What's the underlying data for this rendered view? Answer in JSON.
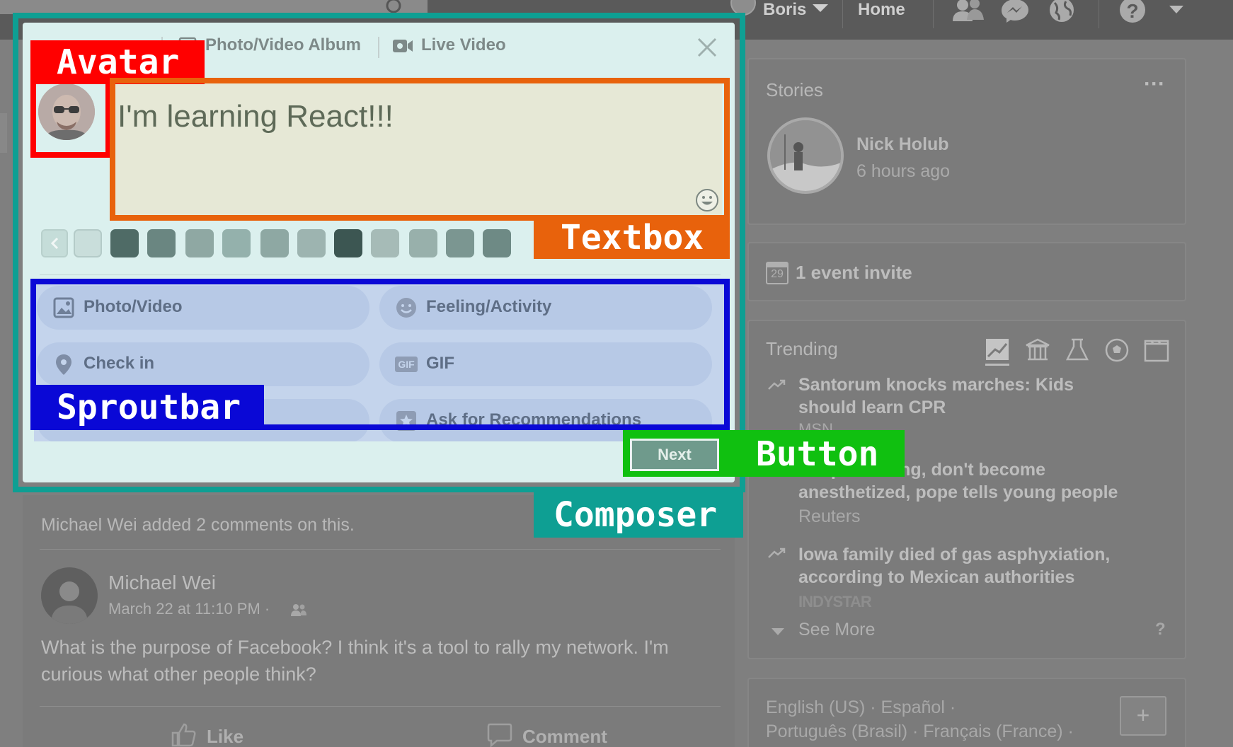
{
  "topbar": {
    "user_name": "Boris",
    "home_label": "Home"
  },
  "composer": {
    "tabs": [
      "Photo/Video Album",
      "Live Video"
    ],
    "text": "I'm learning React!!!",
    "sprout_items": [
      {
        "label": "Photo/Video",
        "icon": "photo-icon"
      },
      {
        "label": "Feeling/Activity",
        "icon": "smiley-icon"
      },
      {
        "label": "Check in",
        "icon": "location-pin-icon"
      },
      {
        "label": "GIF",
        "icon": "gif-icon"
      },
      {
        "label": "",
        "icon": ""
      },
      {
        "label": "Ask for Recommendations",
        "icon": "star-icon"
      }
    ],
    "gif_badge": "GIF",
    "next_label": "Next"
  },
  "annotations": {
    "avatar": "Avatar",
    "textbox": "Textbox",
    "sproutbar": "Sproutbar",
    "button": "Button",
    "composer": "Composer",
    "colors": {
      "avatar": "#ff0000",
      "textbox": "#e8620c",
      "sproutbar": "#0a08d6",
      "button": "#10c010",
      "composer": "#0e9f93"
    }
  },
  "stories": {
    "title": "Stories",
    "name": "Nick Holub",
    "time": "6 hours ago"
  },
  "events": {
    "date_badge": "29",
    "label": "1 event invite"
  },
  "trending": {
    "title": "Trending",
    "items": [
      {
        "headline": "Santorum knocks marches: Kids should learn CPR",
        "source": "MSN"
      },
      {
        "headline": "Keep shouting, don't become anesthetized, pope tells young people",
        "source": "Reuters"
      },
      {
        "headline": "Iowa family died of gas asphyxiation, according to Mexican authorities",
        "source": "INDYSTAR"
      }
    ],
    "see_more": "See More",
    "help": "?"
  },
  "languages": {
    "line1": "English (US) · Español ·",
    "line2": "Português (Brasil) · Français (France) ·",
    "add": "+"
  },
  "post": {
    "activity": "Michael Wei added 2 comments on this.",
    "author": "Michael Wei",
    "meta": "March 22 at 11:10 PM ·",
    "body_line1": "What is the purpose of Facebook? I think it's a tool to rally my network. I'm",
    "body_line2": "curious what other people think?",
    "like": "Like",
    "comment": "Comment"
  }
}
